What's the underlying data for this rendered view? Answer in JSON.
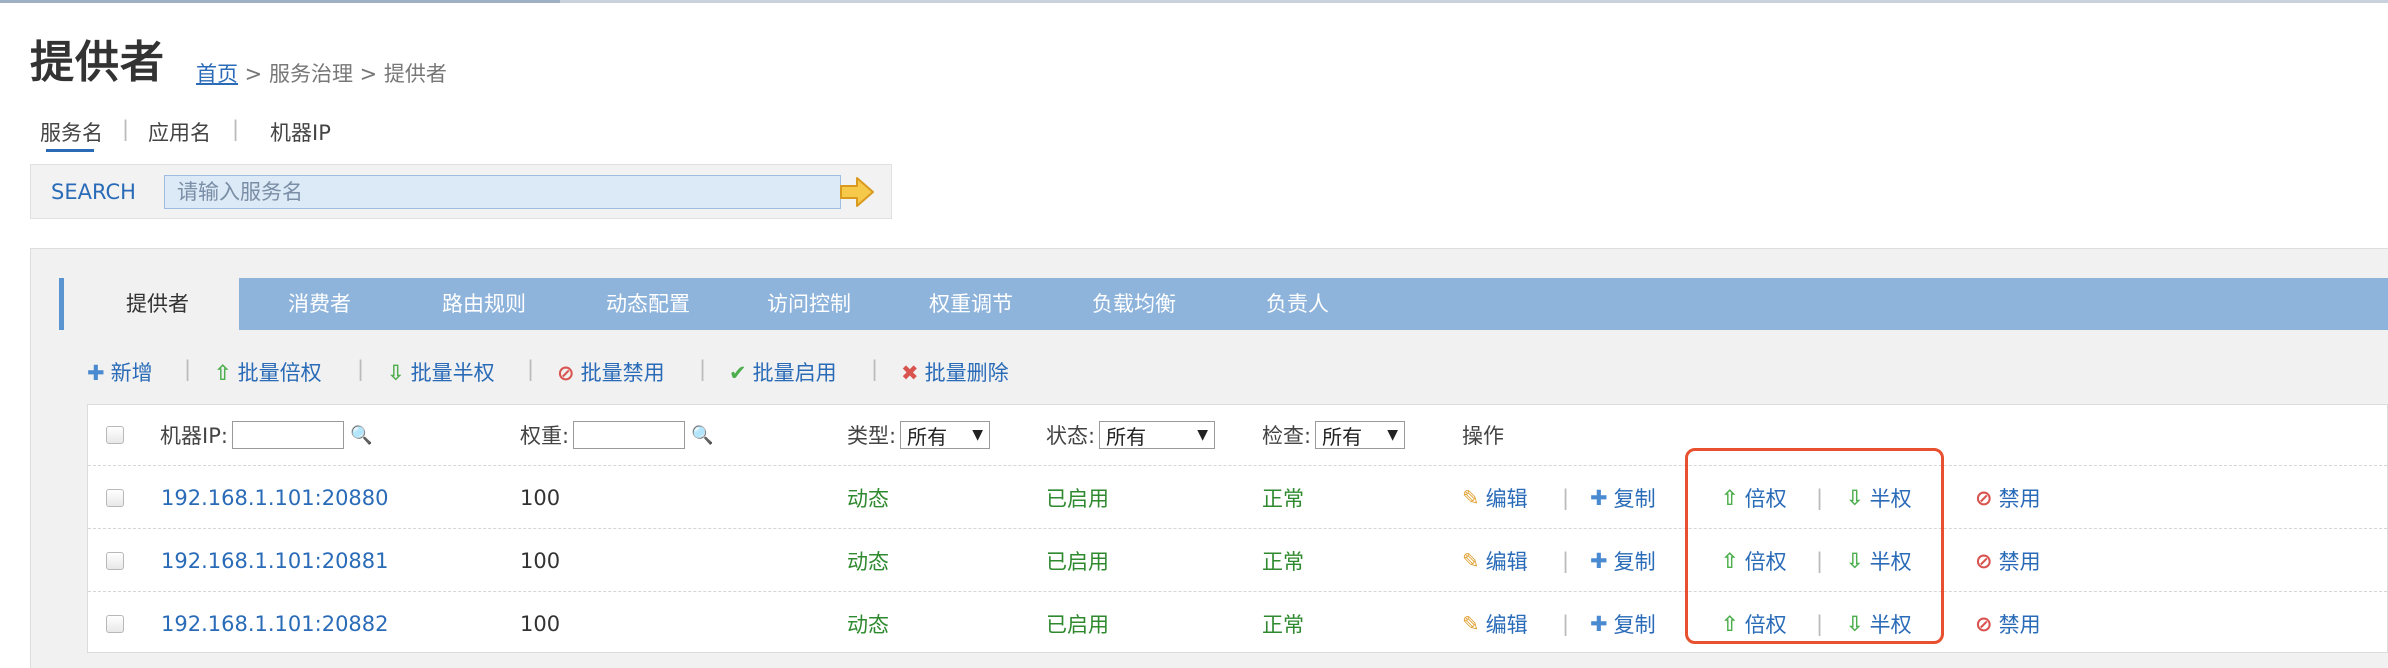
{
  "page": {
    "title": "提供者",
    "breadcrumb": {
      "home": "首页",
      "rest": " > 服务治理 > 提供者"
    }
  },
  "search_tabs": [
    "服务名",
    "应用名",
    "机器IP"
  ],
  "search_tab_separator": "|",
  "search": {
    "label": "SEARCH",
    "placeholder": "请输入服务名"
  },
  "tabs": [
    "提供者",
    "消费者",
    "路由规则",
    "动态配置",
    "访问控制",
    "权重调节",
    "负载均衡",
    "负责人"
  ],
  "bulk_actions": [
    {
      "label": "新增",
      "icon": "plus-icon"
    },
    {
      "label": "批量倍权",
      "icon": "arrow-up-icon"
    },
    {
      "label": "批量半权",
      "icon": "arrow-down-icon"
    },
    {
      "label": "批量禁用",
      "icon": "ban-icon"
    },
    {
      "label": "批量启用",
      "icon": "check-icon"
    },
    {
      "label": "批量删除",
      "icon": "x-icon"
    }
  ],
  "separator": "|",
  "table": {
    "headers": {
      "ip": "机器IP:",
      "weight": "权重:",
      "type": "类型:",
      "status": "状态:",
      "check": "检查:",
      "ops": "操作"
    },
    "filters": {
      "type": "所有",
      "status": "所有",
      "check": "所有"
    },
    "rows": [
      {
        "ip": "192.168.1.101:20880",
        "weight": "100",
        "type": "动态",
        "status": "已启用",
        "check": "正常"
      },
      {
        "ip": "192.168.1.101:20881",
        "weight": "100",
        "type": "动态",
        "status": "已启用",
        "check": "正常"
      },
      {
        "ip": "192.168.1.101:20882",
        "weight": "100",
        "type": "动态",
        "status": "已启用",
        "check": "正常"
      }
    ],
    "row_ops": {
      "edit": "编辑",
      "copy": "复制",
      "double": "倍权",
      "half": "半权",
      "disable": "禁用"
    }
  },
  "colors": {
    "accent": "#2a6bb8",
    "tabbar": "#8fb4dc",
    "highlight_box": "#e8512f",
    "ok_green": "#2f8a2f"
  }
}
